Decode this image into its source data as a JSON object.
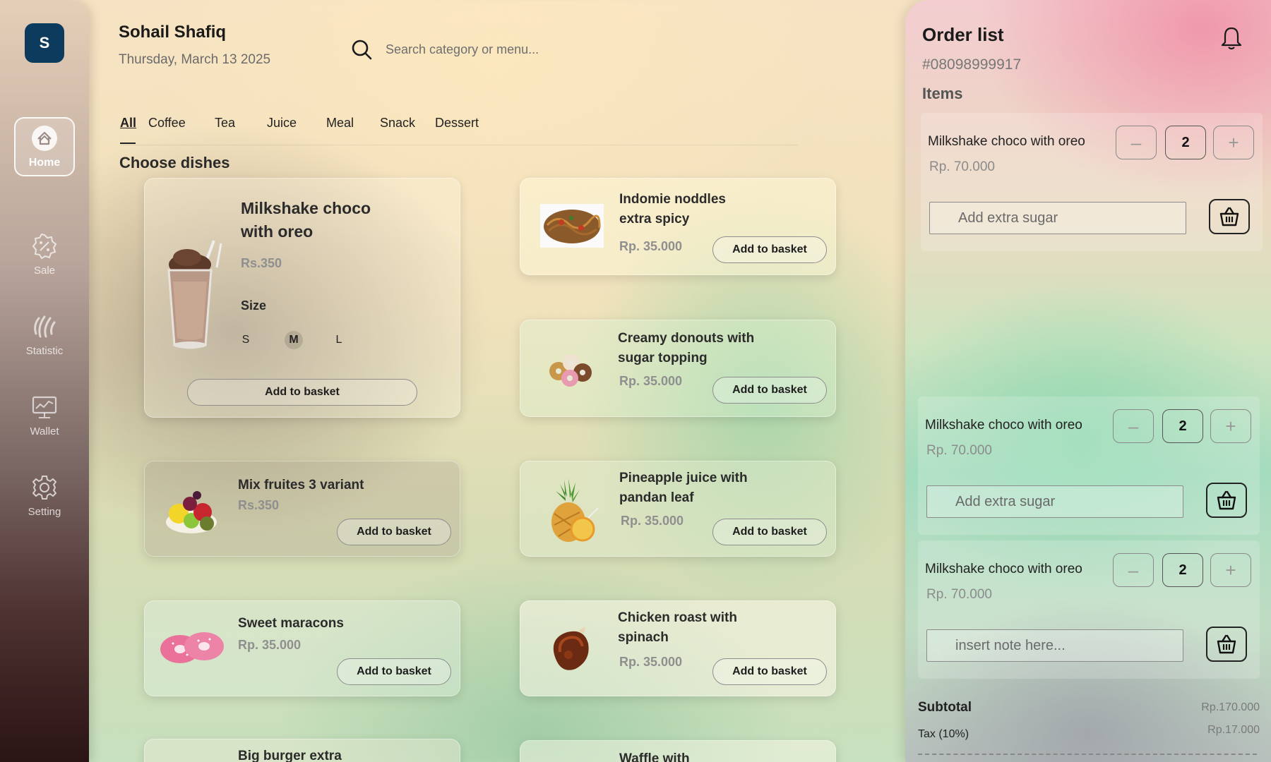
{
  "sidebar": {
    "avatar_initial": "S",
    "items": [
      {
        "label": "Home",
        "icon": "home-icon",
        "active": true
      },
      {
        "label": "Sale",
        "icon": "discount-icon"
      },
      {
        "label": "Statistic",
        "icon": "statistic-icon"
      },
      {
        "label": "Wallet",
        "icon": "wallet-icon"
      },
      {
        "label": "Setting",
        "icon": "gear-icon"
      }
    ]
  },
  "header": {
    "user_name": "Sohail Shafiq",
    "date": "Thursday, March 13 2025",
    "search_placeholder": "Search category or menu..."
  },
  "tabs": [
    "All",
    "Coffee",
    "Tea",
    "Juice",
    "Meal",
    "Snack",
    "Dessert"
  ],
  "active_tab": "All",
  "section_title": "Choose dishes",
  "dishes": {
    "featured": {
      "name_line1": "Milkshake choco",
      "name_line2": "with  oreo",
      "price": "Rs.350",
      "size_label": "Size",
      "sizes": [
        "S",
        "M",
        "L"
      ],
      "selected_size": "M",
      "button": "Add to basket",
      "image": "milkshake-image"
    },
    "list": [
      {
        "name_line1": "Indomie noddles",
        "name_line2": "extra spicy",
        "price": "Rp. 35.000",
        "button": "Add to basket",
        "image": "noodles-image"
      },
      {
        "name_line1": "Creamy donouts with",
        "name_line2": "sugar topping",
        "price": "Rp. 35.000",
        "button": "Add to basket",
        "image": "donuts-image"
      },
      {
        "name_line1": "Mix fruites 3 variant",
        "name_line2": "",
        "price": "Rs.350",
        "button": "Add to basket",
        "image": "fruits-image"
      },
      {
        "name_line1": "Pineapple juice with",
        "name_line2": "pandan leaf",
        "price": "Rp. 35.000",
        "button": "Add to basket",
        "image": "pineapple-image"
      },
      {
        "name_line1": "Sweet maracons",
        "name_line2": "",
        "price": "Rp. 35.000",
        "button": "Add to basket",
        "image": "macarons-image"
      },
      {
        "name_line1": "Chicken roast with",
        "name_line2": "spinach",
        "price": "Rp. 35.000",
        "button": "Add to basket",
        "image": "chicken-image"
      },
      {
        "name_line1": "Big burger extra",
        "name_line2": "",
        "price": "",
        "button": "",
        "image": ""
      },
      {
        "name_line1": "Waffle with",
        "name_line2": "",
        "price": "",
        "button": "",
        "image": ""
      }
    ]
  },
  "order": {
    "title": "Order list",
    "order_id": "#08098999917",
    "items_label": "Items",
    "items": [
      {
        "name": "Milkshake choco with  oreo",
        "price": "Rp. 70.000",
        "qty": "2",
        "note_placeholder": "Add extra sugar",
        "minus": "–",
        "plus": "+"
      },
      {
        "name": "Milkshake choco with  oreo",
        "price": "Rp. 70.000",
        "qty": "2",
        "note_placeholder": "Add extra sugar",
        "minus": "–",
        "plus": "+"
      },
      {
        "name": "Milkshake choco with  oreo",
        "price": "Rp. 70.000",
        "qty": "2",
        "note_placeholder": "insert note here...",
        "minus": "–",
        "plus": "+"
      }
    ],
    "subtotal_label": "Subtotal",
    "subtotal_value": "Rp.170.000",
    "tax_label": "Tax (10%)",
    "tax_value": "Rp.17.000"
  },
  "colors": {
    "avatar_bg": "#0d3b5e",
    "price_gray": "#8f8f8f",
    "accent_pink": "#f096aa",
    "accent_green": "#8cd7af"
  }
}
